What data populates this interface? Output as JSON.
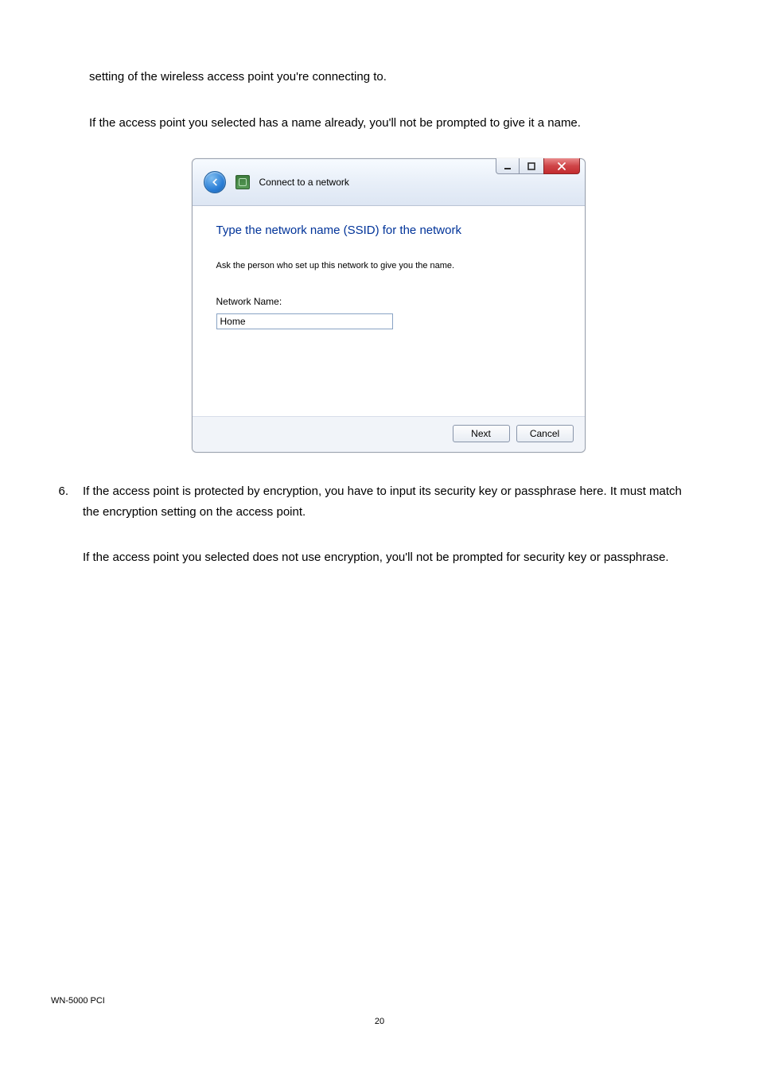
{
  "paragraphs": {
    "p1": "setting of the wireless access point you're connecting to.",
    "p2": "If the access point you selected has a name already, you'll not be prompted to give it a name."
  },
  "dialog": {
    "title": "Connect to a network",
    "heading": "Type the network name (SSID) for the network",
    "subtext": "Ask the person who set up this network to give you the name.",
    "field_label": "Network Name:",
    "field_value": "Home",
    "buttons": {
      "next": "Next",
      "cancel": "Cancel"
    }
  },
  "list": {
    "number": "6.",
    "p1": "If the access point is protected by encryption, you have to input its security key or passphrase here. It must match the encryption setting on the access point.",
    "p2": "If the access point you selected does not use encryption, you'll not be prompted for security key or passphrase."
  },
  "footer": {
    "model": "WN-5000 PCI",
    "page": "20"
  }
}
